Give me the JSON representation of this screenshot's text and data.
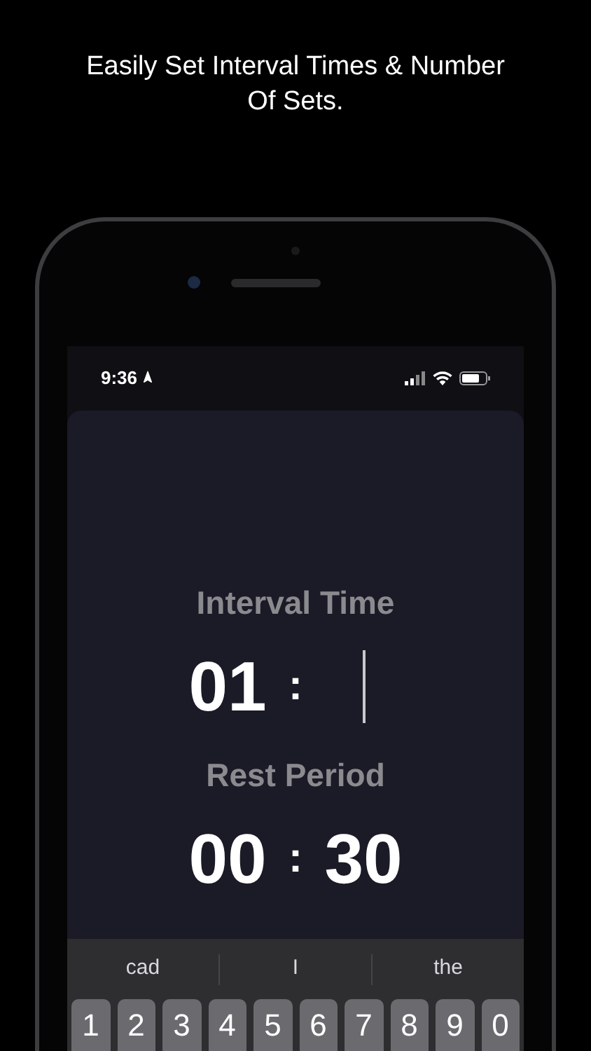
{
  "caption": "Easily Set Interval Times & Number Of Sets.",
  "status_bar": {
    "time": "9:36"
  },
  "timers": [
    {
      "label": "Interval Time",
      "minutes": "01",
      "separator": ":",
      "focused": true
    },
    {
      "label": "Rest Period",
      "minutes": "00",
      "separator": ":",
      "seconds": "30",
      "focused": false
    }
  ],
  "keyboard": {
    "suggestions": [
      "cad",
      "I",
      "the"
    ],
    "keys": [
      "1",
      "2",
      "3",
      "4",
      "5",
      "6",
      "7",
      "8",
      "9",
      "0"
    ]
  }
}
